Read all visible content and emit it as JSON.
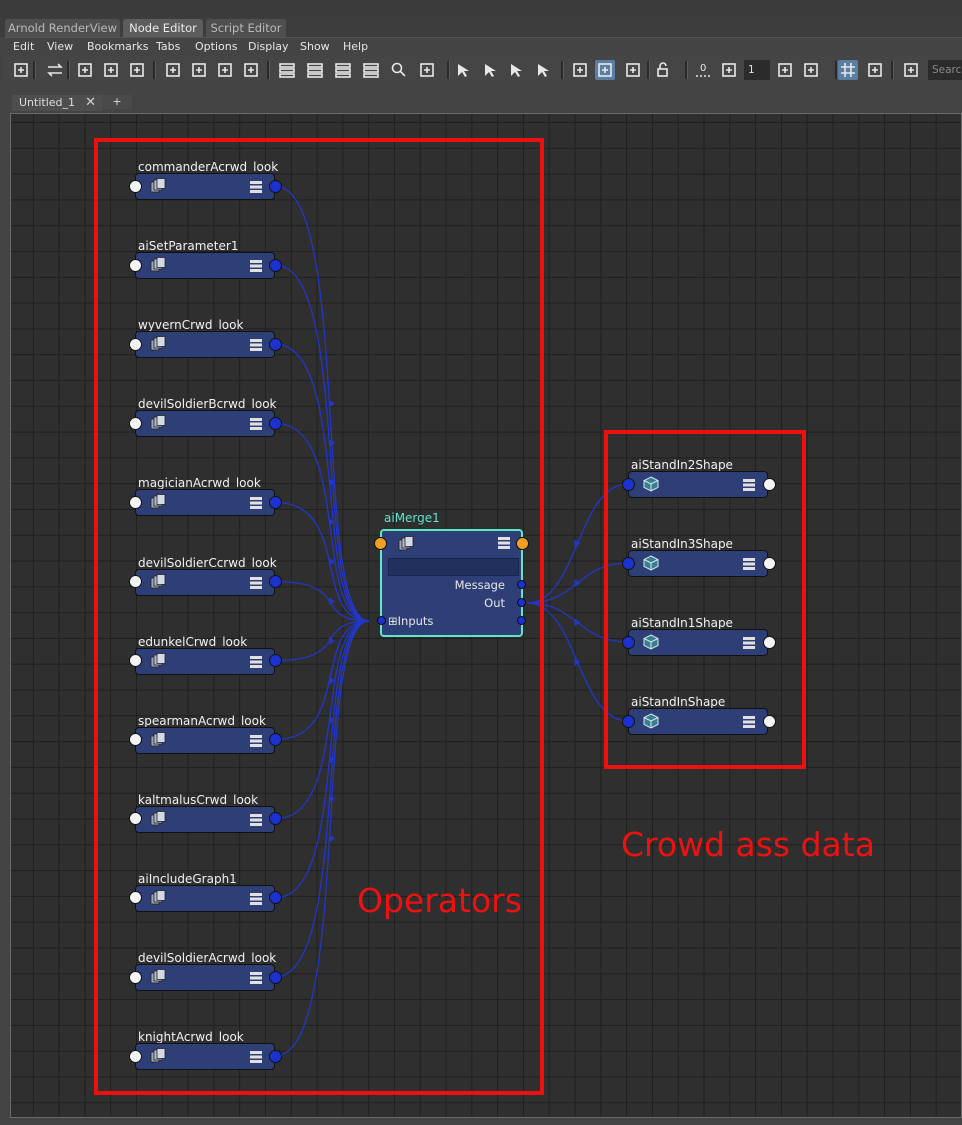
{
  "tabs": [
    {
      "label": "Arnold RenderView",
      "active": false
    },
    {
      "label": "Node Editor",
      "active": true
    },
    {
      "label": "Script Editor",
      "active": false
    }
  ],
  "menu": [
    "Edit",
    "View",
    "Bookmarks",
    "Tabs",
    "Options",
    "Display",
    "Show",
    "Help"
  ],
  "toolbar": {
    "icons": [
      "add-selected-icon",
      "swap-icon",
      "input-connections-icon",
      "input-output-connections-icon",
      "output-connections-icon",
      "frame-all-icon",
      "frame-selected-icon",
      "layout-icon",
      "pin-icon",
      "simple-mode-icon",
      "connected-mode-icon",
      "full-mode-icon",
      "custom-mode-icon",
      "search-icon",
      "rename-icon",
      "graph-selection-icon",
      "graph-remove-icon",
      "graph-upstream-icon",
      "graph-downstream-icon",
      "filter-icon",
      "select-mode-icon",
      "shading-icon",
      "lock-icon",
      "zero-icon",
      "step-icon",
      "fit-icon",
      "chain-icon",
      "grid-icon",
      "snap-icon",
      "frame-icon"
    ],
    "zero_label": "0",
    "step_value": "1",
    "search_placeholder": "Search"
  },
  "document_tab": {
    "label": "Untitled_1",
    "add_label": "+"
  },
  "operators": [
    "commanderAcrwd_look",
    "aiSetParameter1",
    "wyvernCrwd_look",
    "devilSoldierBcrwd_look",
    "magicianAcrwd_look",
    "devilSoldierCcrwd_look",
    "edunkelCrwd_look",
    "spearmanAcrwd_look",
    "kaltmalusCrwd_look",
    "aiIncludeGraph1",
    "devilSoldierAcrwd_look",
    "knightAcrwd_look"
  ],
  "merge_node": {
    "name": "aiMerge1",
    "attr_message": "Message",
    "attr_out": "Out",
    "attr_inputs": "Inputs",
    "expand_glyph": "⊞"
  },
  "standins": [
    "aiStandIn2Shape",
    "aiStandIn3Shape",
    "aiStandIn1Shape",
    "aiStandInShape"
  ],
  "annotations": {
    "operators_label": "Operators",
    "crowd_label": "Crowd ass data"
  },
  "colors": {
    "node_body": "#2e3f78",
    "selected_outline": "#5fe6c7",
    "annotation_red": "#ee1111",
    "wire": "#2236c8"
  }
}
